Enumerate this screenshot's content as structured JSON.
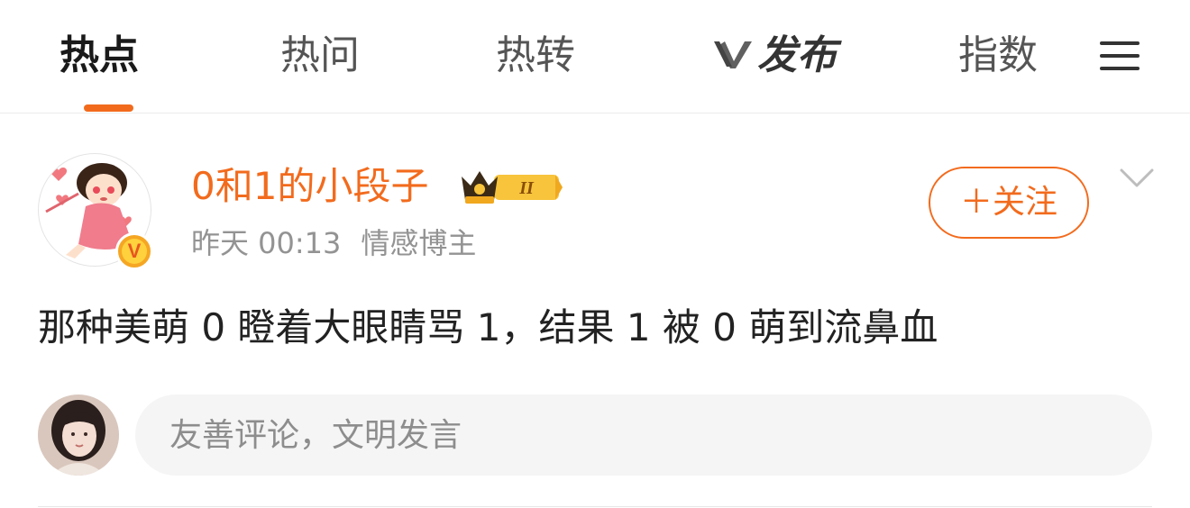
{
  "tabs": [
    {
      "label": "热点",
      "active": true
    },
    {
      "label": "热问",
      "active": false
    },
    {
      "label": "热转",
      "active": false
    },
    {
      "label": "发布",
      "active": false
    },
    {
      "label": "指数",
      "active": false
    }
  ],
  "colors": {
    "accent": "#f26b1d",
    "meta_text": "#939393",
    "input_bg": "#f5f5f5",
    "badge_gold": "#ffd13d"
  },
  "post": {
    "username": "0和1的小段子",
    "level_badge": "II",
    "time": "昨天 00:13",
    "role": "情感博主",
    "verified_badge": "V",
    "follow_label": "＋关注",
    "content": "那种美萌 0 瞪着大眼睛骂 1，结果 1 被 0 萌到流鼻血"
  },
  "comment": {
    "placeholder": "友善评论，文明发言"
  },
  "icons": [
    "menu-icon",
    "chevron-down-icon",
    "crown-badge-icon",
    "verified-v-icon",
    "v-logo-icon"
  ]
}
